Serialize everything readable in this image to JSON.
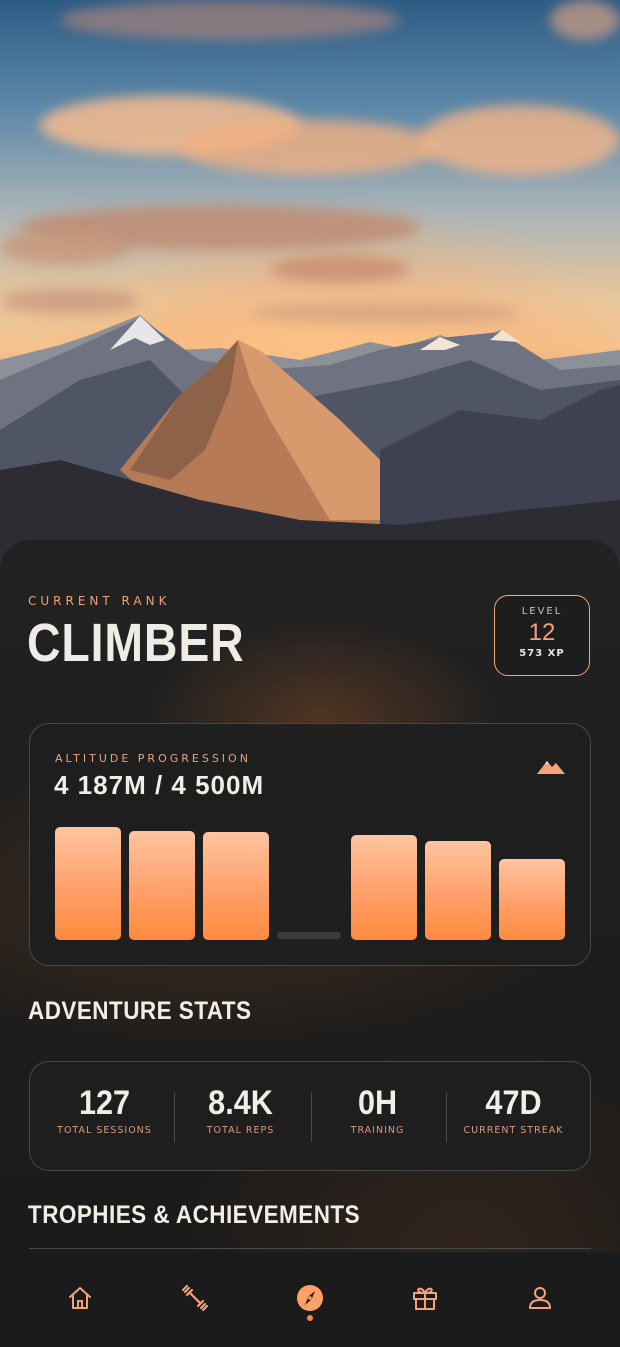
{
  "rank": {
    "label": "CURRENT RANK",
    "title": "CLIMBER"
  },
  "level": {
    "label": "LEVEL",
    "value": "12",
    "xp": "573 XP"
  },
  "altitude": {
    "label": "ALTITUDE PROGRESSION",
    "value": "4 187M / 4 500M",
    "icon": "mountain-icon",
    "bars": [
      0.88,
      0.85,
      0.84,
      0.0,
      0.82,
      0.77,
      0.63
    ]
  },
  "stats": {
    "title": "ADVENTURE STATS",
    "items": [
      {
        "value": "127",
        "label": "TOTAL SESSIONS"
      },
      {
        "value": "8.4K",
        "label": "TOTAL REPS"
      },
      {
        "value": "0H",
        "label": "TRAINING"
      },
      {
        "value": "47D",
        "label": "CURRENT STREAK"
      }
    ]
  },
  "trophies": {
    "title": "TROPHIES & ACHIEVEMENTS"
  },
  "nav": {
    "items": [
      {
        "icon": "home-icon",
        "active": false
      },
      {
        "icon": "dumbbell-icon",
        "active": false
      },
      {
        "icon": "compass-icon",
        "active": true
      },
      {
        "icon": "gift-icon",
        "active": false
      },
      {
        "icon": "profile-icon",
        "active": false
      }
    ]
  },
  "colors": {
    "accent": "#ff8a3d",
    "accent_light": "#f4a27b",
    "panel": "#1e1e1f"
  }
}
